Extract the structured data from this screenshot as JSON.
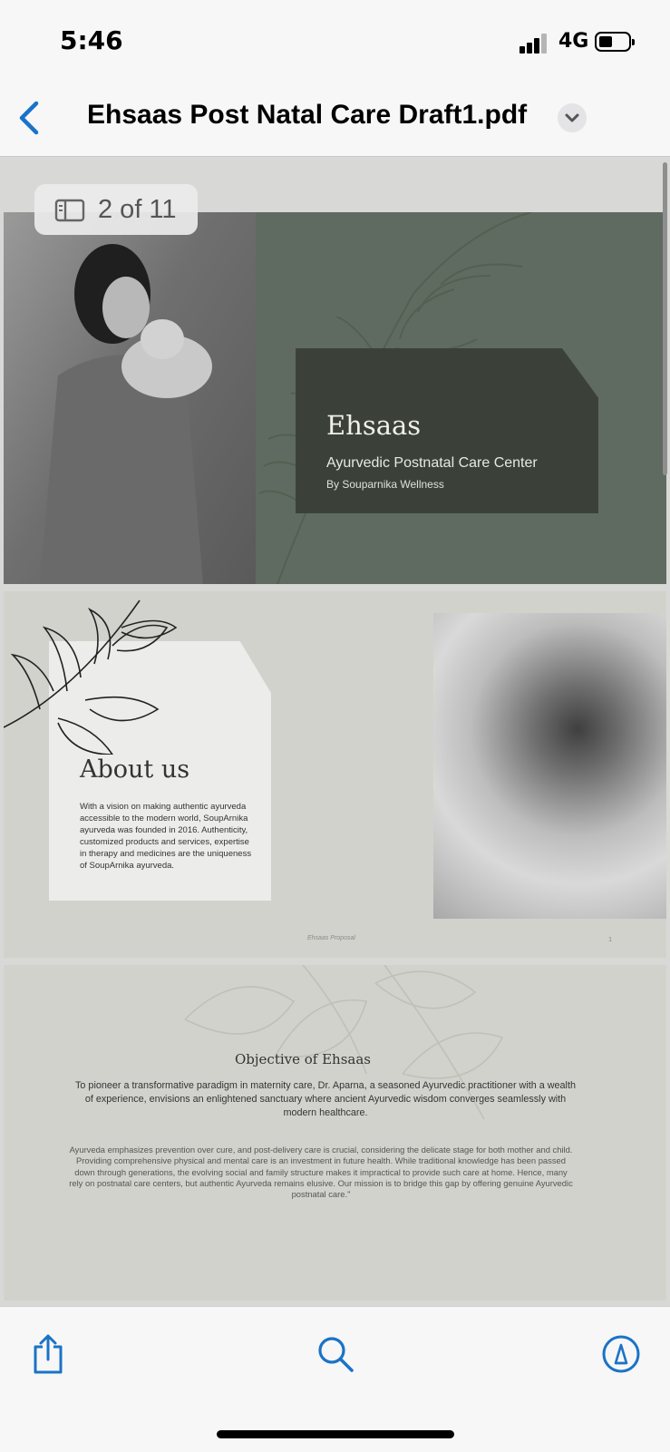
{
  "status": {
    "time": "5:46",
    "network": "4G"
  },
  "nav": {
    "title": "Ehsaas Post Natal Care Draft1.pdf"
  },
  "viewer": {
    "page_indicator": "2 of 11"
  },
  "slide1": {
    "heading": "Ehsaas",
    "subtitle": "Ayurvedic Postnatal Care Center",
    "byline": "By Souparnika  Wellness"
  },
  "slide2": {
    "heading": "About us",
    "body": "With a vision on making authentic ayurveda accessible to the modern world, SoupArnika ayurveda was founded in 2016. Authenticity, customized products and services, expertise  in therapy and medicines  are the uniqueness of SoupArnika ayurveda.",
    "footer": "Ehsaas Proposal",
    "page_number": "1"
  },
  "slide3": {
    "heading": "Objective of Ehsaas",
    "para1": "To pioneer a transformative paradigm in maternity care, Dr. Aparna, a seasoned  Ayurvedic practitioner with a wealth of experience,  envisions an enlightened  sanctuary where ancient Ayurvedic wisdom converges seamlessly  with modern healthcare.",
    "para2": "Ayurveda emphasizes prevention over cure, and post-delivery care is crucial, considering the delicate stage for both mother and child. Providing comprehensive physical and mental care is an investment in future health. While traditional knowledge has been passed down through generations, the evolving social and   family structure makes it impractical to provide such care at home. Hence, many rely on postnatal care centers, but authentic Ayurveda remains elusive. Our mission is to bridge this gap by offering genuine Ayurvedic postnatal care.\""
  },
  "toolbar": {
    "icons": [
      "share-icon",
      "search-icon",
      "markup-icon"
    ]
  },
  "colors": {
    "accent": "#1a73c7",
    "slide_green": "#5f6b61",
    "slide_dark_box": "#3b4139"
  }
}
